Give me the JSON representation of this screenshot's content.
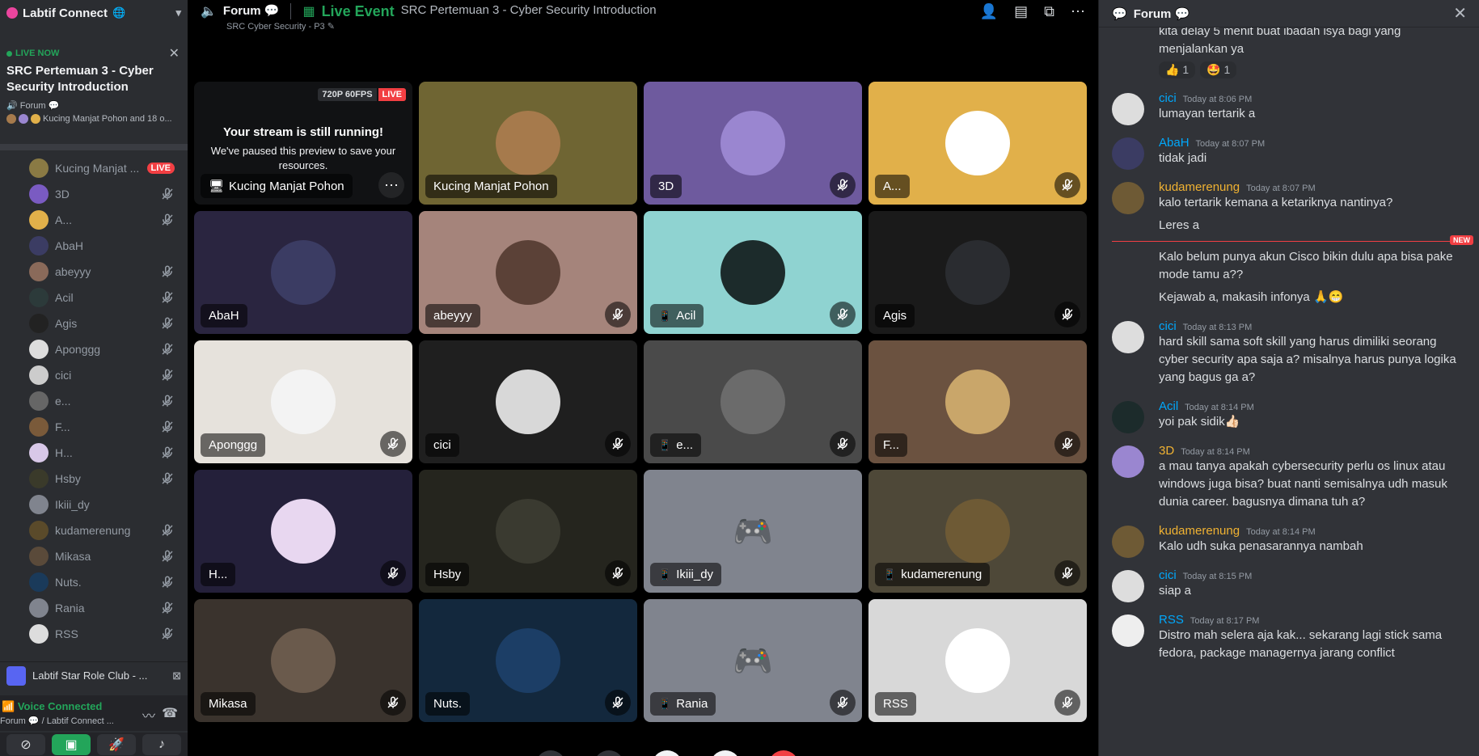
{
  "sidebar": {
    "server_name": "Labtif Connect",
    "live": {
      "badge": "LIVE NOW",
      "title": "SRC Pertemuan 3 - Cyber Security Introduction",
      "channel": "Forum",
      "users_text": "Kucing Manjat Pohon and 18 o..."
    },
    "users": [
      {
        "name": "Kucing Manjat ...",
        "live": "LIVE",
        "color": "#8a7a44"
      },
      {
        "name": "3D",
        "color": "#7a5bc2"
      },
      {
        "name": "A...",
        "color": "#e1b04a"
      },
      {
        "name": "AbaH",
        "color": "#3b3c63"
      },
      {
        "name": "abeyyy",
        "color": "#8a6a5a"
      },
      {
        "name": "Acil",
        "color": "#2c3a3a"
      },
      {
        "name": "Agis",
        "color": "#222"
      },
      {
        "name": "Aponggg",
        "color": "#ddd"
      },
      {
        "name": "cici",
        "color": "#ccc"
      },
      {
        "name": "e...",
        "color": "#666"
      },
      {
        "name": "F...",
        "color": "#7a5a3a"
      },
      {
        "name": "H...",
        "color": "#d8c8e8"
      },
      {
        "name": "Hsby",
        "color": "#3a3a2a"
      },
      {
        "name": "Ikiii_dy",
        "color": "#80848e"
      },
      {
        "name": "kudamerenung",
        "color": "#5a4a2a"
      },
      {
        "name": "Mikasa",
        "color": "#5a4a3a"
      },
      {
        "name": "Nuts.",
        "color": "#1a3a5a"
      },
      {
        "name": "Rania",
        "color": "#80848e"
      },
      {
        "name": "RSS",
        "color": "#ddd"
      }
    ],
    "club": "Labtif Star Role Club - ...",
    "voice_status": "Voice Connected",
    "voice_sub": "Forum 💬 / Labtif Connect ..."
  },
  "stage": {
    "channel": "Forum 💬",
    "event_label": "Live Event",
    "event_title": "SRC Pertemuan 3 - Cyber Security Introduction",
    "crumb": "SRC Cyber Security - P3"
  },
  "stream_tile": {
    "quality": "720P 60FPS",
    "live": "LIVE",
    "heading": "Your stream is still running!",
    "body": "We've paused this preview to save your resources.",
    "name": "Kucing Manjat Pohon"
  },
  "tiles": [
    {
      "name": "Kucing Manjat Pohon",
      "bg": "#6f6533",
      "pfp": "#a67a4c",
      "muted": false,
      "phone": false
    },
    {
      "name": "3D",
      "bg": "#6e5a9e",
      "pfp": "#9a86d0",
      "muted": true,
      "phone": false
    },
    {
      "name": "A...",
      "bg": "#e1b04a",
      "pfp": "#ffffff",
      "muted": true,
      "phone": false
    },
    {
      "name": "AbaH",
      "bg": "#2a2540",
      "pfp": "#3b3c63",
      "muted": false,
      "phone": false
    },
    {
      "name": "abeyyy",
      "bg": "#a5847b",
      "pfp": "#5b4137",
      "muted": true,
      "phone": false
    },
    {
      "name": "Acil",
      "bg": "#8fd3d1",
      "pfp": "#1c2b2b",
      "muted": true,
      "phone": true
    },
    {
      "name": "Agis",
      "bg": "#1a1a1a",
      "pfp": "#2a2c30",
      "muted": true,
      "phone": false
    },
    {
      "name": "Aponggg",
      "bg": "#e6e2dc",
      "pfp": "#f3f3f3",
      "muted": true,
      "phone": false
    },
    {
      "name": "cici",
      "bg": "#1f1f1f",
      "pfp": "#d8d8d8",
      "muted": true,
      "phone": false
    },
    {
      "name": "e...",
      "bg": "#4a4a4a",
      "pfp": "#6b6b6b",
      "muted": true,
      "phone": true
    },
    {
      "name": "F...",
      "bg": "#6b5240",
      "pfp": "#c9a66a",
      "muted": true,
      "phone": false
    },
    {
      "name": "H...",
      "bg": "#24203a",
      "pfp": "#e8d7f0",
      "muted": true,
      "phone": false
    },
    {
      "name": "Hsby",
      "bg": "#25251e",
      "pfp": "#3a3a30",
      "muted": true,
      "phone": false
    },
    {
      "name": "Ikiii_dy",
      "bg": "#80848e",
      "pfp": "discord",
      "muted": false,
      "phone": true
    },
    {
      "name": "kudamerenung",
      "bg": "#4e4838",
      "pfp": "#6e5a35",
      "muted": true,
      "phone": true
    },
    {
      "name": "Mikasa",
      "bg": "#3a332d",
      "pfp": "#6a5a4c",
      "muted": true,
      "phone": false
    },
    {
      "name": "Nuts.",
      "bg": "#13283d",
      "pfp": "#1c3e66",
      "muted": true,
      "phone": false
    },
    {
      "name": "Rania",
      "bg": "#80848e",
      "pfp": "discord",
      "muted": true,
      "phone": true
    },
    {
      "name": "RSS",
      "bg": "#d8d8d8",
      "pfp": "#ffffff",
      "muted": true,
      "phone": false
    }
  ],
  "chat": {
    "title": "Forum 💬",
    "cont_text": "kita delay 5 menit buat ibadah isya bagi yang menjalankan ya",
    "reactions": [
      {
        "emoji": "👍",
        "count": "1"
      },
      {
        "emoji": "🤩",
        "count": "1"
      }
    ],
    "new_badge": "NEW",
    "messages": [
      {
        "author": "cici",
        "color": "#00a8fc",
        "time": "Today at 8:06 PM",
        "lines": [
          "lumayan tertarik a"
        ],
        "av": "#ddd"
      },
      {
        "author": "AbaH",
        "color": "#00a8fc",
        "time": "Today at 8:07 PM",
        "lines": [
          "tidak jadi"
        ],
        "av": "#3b3c63"
      },
      {
        "author": "kudamerenung",
        "color": "#f0b232",
        "time": "Today at 8:07 PM",
        "lines": [
          "kalo tertarik kemana a ketariknya nantinya?",
          "Leres a"
        ],
        "av": "#6e5a35"
      },
      {
        "author": "",
        "color": "",
        "time": "",
        "lines": [
          "Kalo belum punya akun Cisco bikin dulu apa bisa pake mode tamu a??",
          "Kejawab a, makasih infonya 🙏😁"
        ],
        "av": ""
      },
      {
        "author": "cici",
        "color": "#00a8fc",
        "time": "Today at 8:13 PM",
        "lines": [
          "hard skill sama soft skill yang harus dimiliki seorang cyber security apa saja a? misalnya harus punya logika yang bagus ga a?"
        ],
        "av": "#ddd"
      },
      {
        "author": "Acil",
        "color": "#00a8fc",
        "time": "Today at 8:14 PM",
        "lines": [
          "yoi pak sidik👍🏻"
        ],
        "av": "#1c2b2b"
      },
      {
        "author": "3D",
        "color": "#f0b232",
        "time": "Today at 8:14 PM",
        "lines": [
          "a mau tanya apakah cybersecurity perlu os linux atau windows juga bisa? buat nanti semisalnya udh masuk dunia career. bagusnya dimana tuh a?"
        ],
        "av": "#9a86d0"
      },
      {
        "author": "kudamerenung",
        "color": "#f0b232",
        "time": "Today at 8:14 PM",
        "lines": [
          "Kalo udh suka penasarannya nambah"
        ],
        "av": "#6e5a35"
      },
      {
        "author": "cici",
        "color": "#00a8fc",
        "time": "Today at 8:15 PM",
        "lines": [
          "siap a"
        ],
        "av": "#ddd"
      },
      {
        "author": "RSS",
        "color": "#00a8fc",
        "time": "Today at 8:17 PM",
        "lines": [
          "Distro mah selera aja kak... sekarang lagi stick sama fedora, package managernya jarang conflict"
        ],
        "av": "#eee"
      }
    ]
  }
}
